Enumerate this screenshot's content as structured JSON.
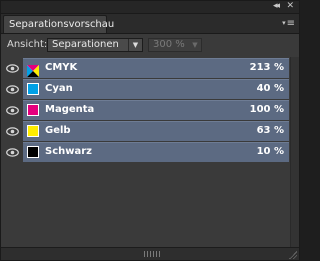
{
  "panel": {
    "title": "Separationsvorschau",
    "collapse_glyph": "◂◂",
    "close_glyph": "✕",
    "menu_arrow": "▾",
    "menu_glyph": "≡"
  },
  "view": {
    "label": "Ansicht:",
    "selected": "Separationen",
    "zoom": "300 %"
  },
  "separations": [
    {
      "name": "CMYK",
      "value": "213 %",
      "swatch": "cmyk"
    },
    {
      "name": "Cyan",
      "value": "40 %",
      "swatch": "#00a0e6"
    },
    {
      "name": "Magenta",
      "value": "100 %",
      "swatch": "#e5007e"
    },
    {
      "name": "Gelb",
      "value": "63 %",
      "swatch": "#ffed00"
    },
    {
      "name": "Schwarz",
      "value": "10 %",
      "swatch": "#000000"
    }
  ],
  "colors": {
    "row_bg": "#5c6a82",
    "panel_bg": "#3a3a3a"
  }
}
